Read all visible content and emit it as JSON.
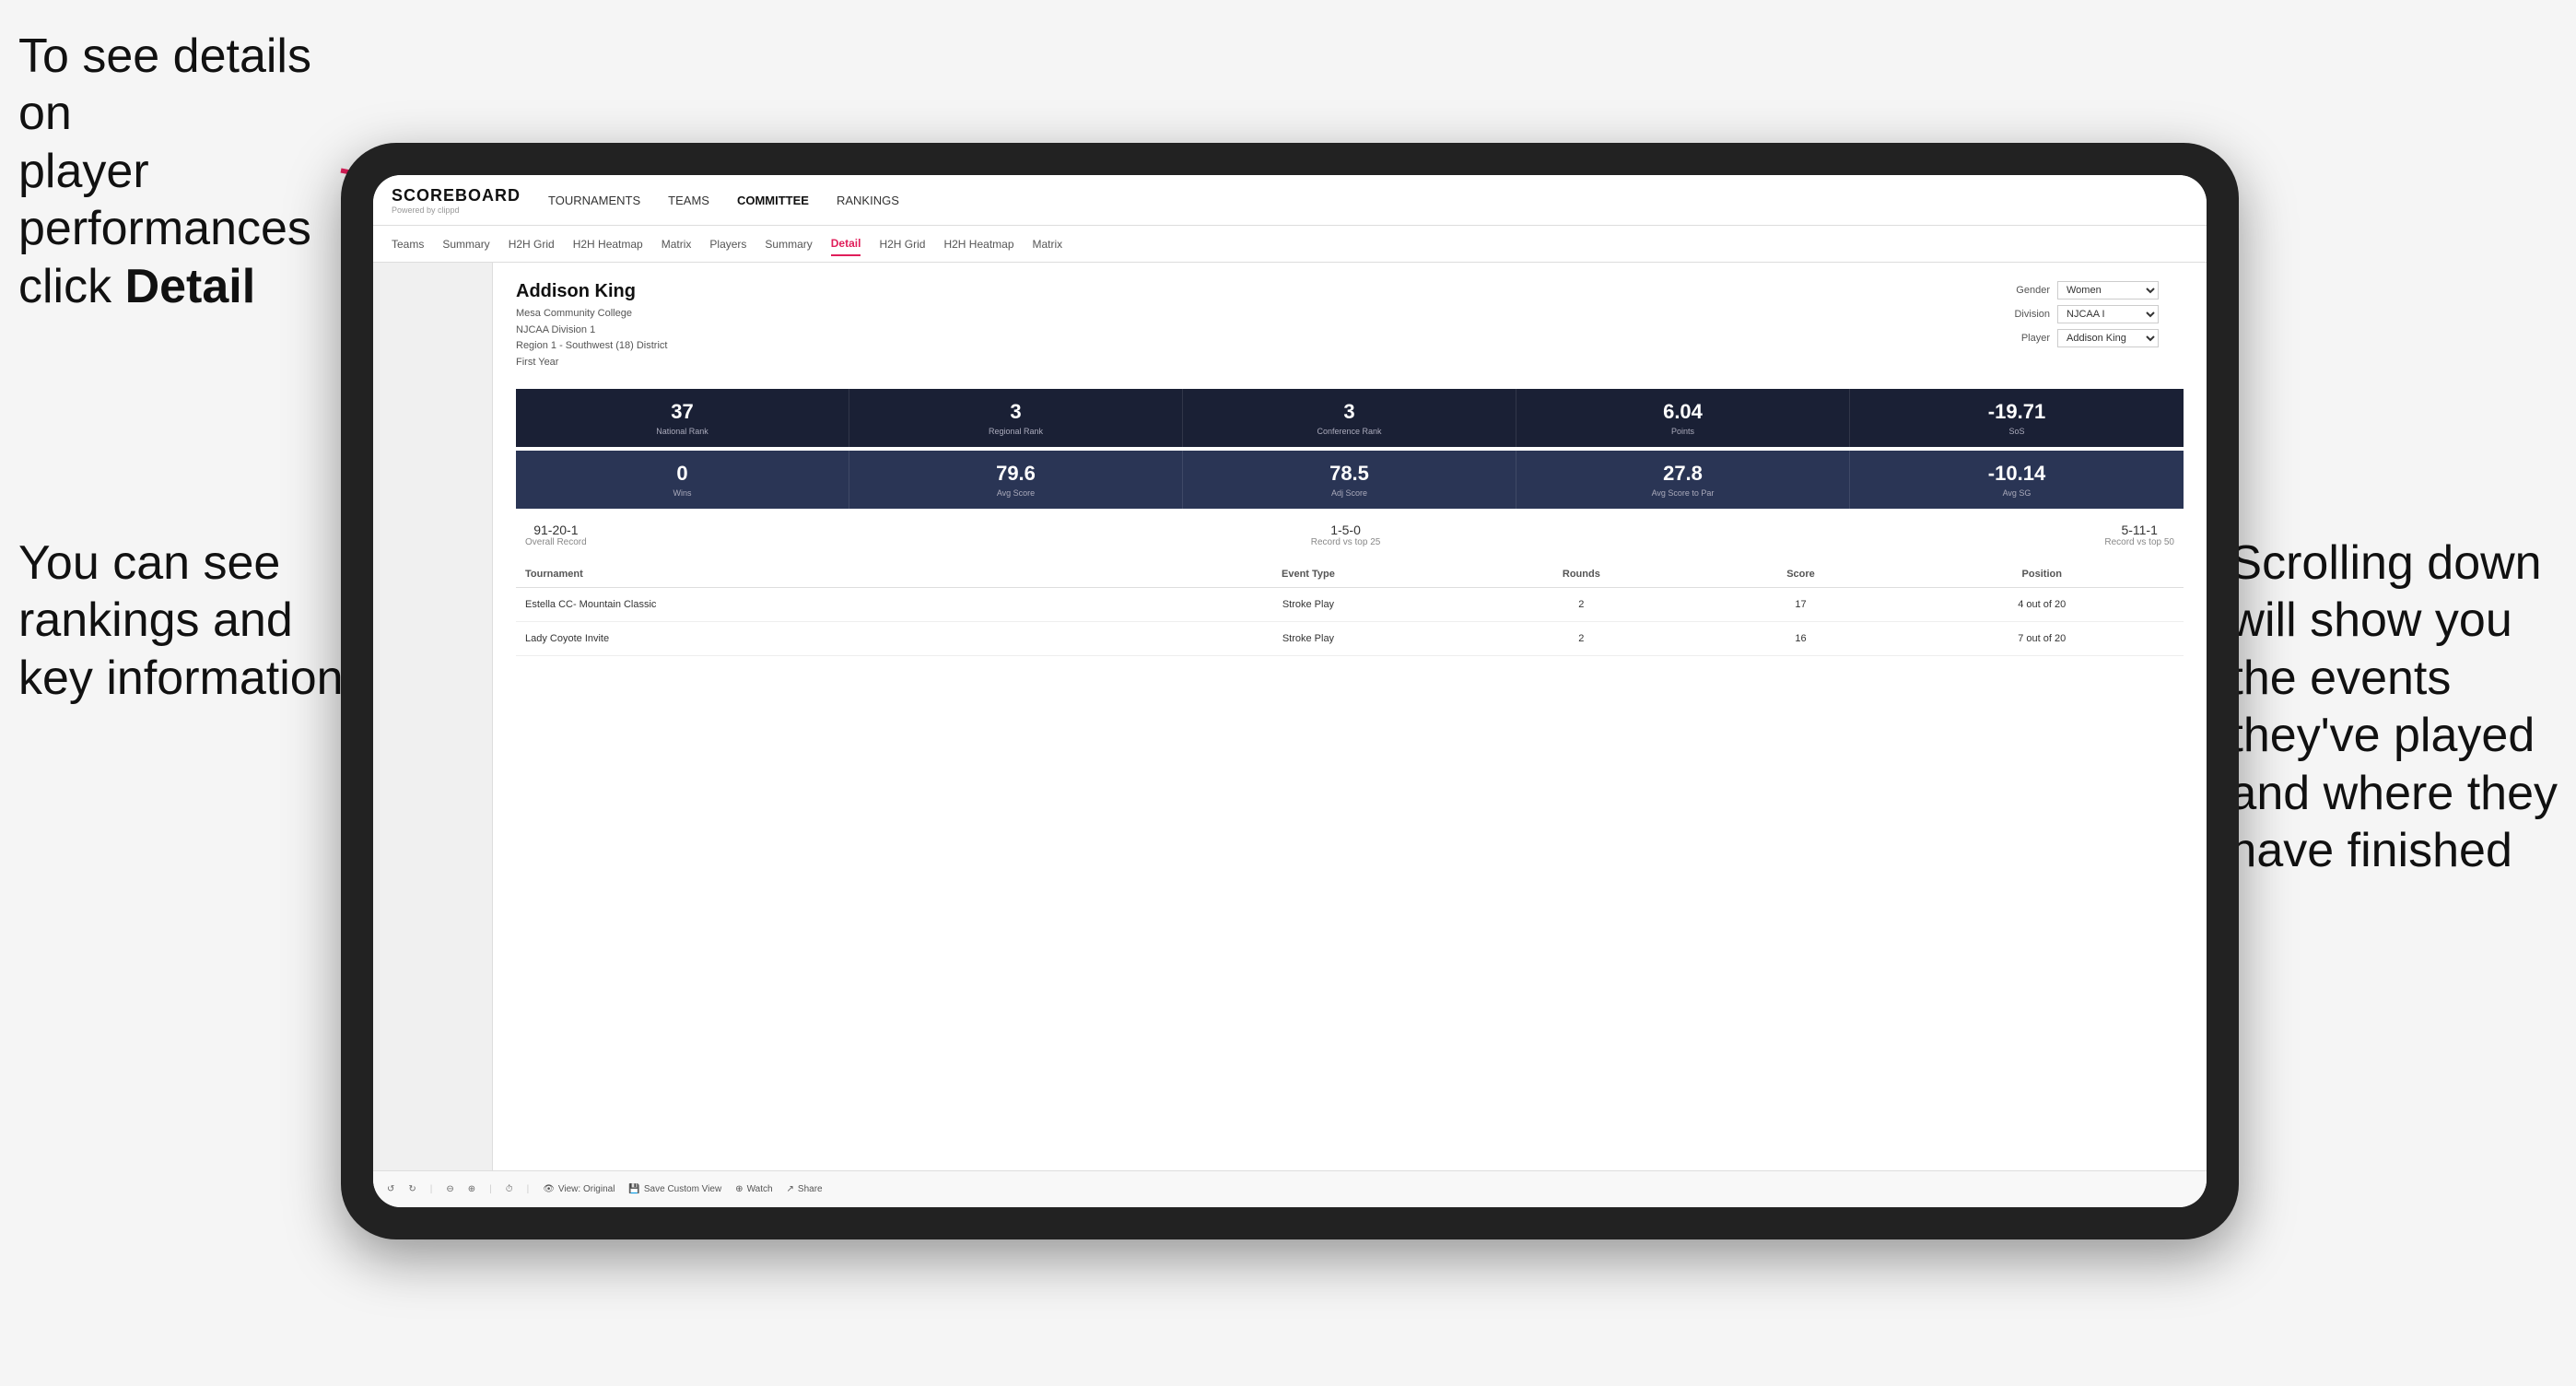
{
  "annotations": {
    "top_left": {
      "line1": "To see details on",
      "line2": "player performances",
      "line3_prefix": "click ",
      "line3_bold": "Detail"
    },
    "bottom_left": {
      "line1": "You can see",
      "line2": "rankings and",
      "line3": "key information"
    },
    "right": {
      "line1": "Scrolling down",
      "line2": "will show you",
      "line3": "the events",
      "line4": "they've played",
      "line5": "and where they",
      "line6": "have finished"
    }
  },
  "nav": {
    "logo": "SCOREBOARD",
    "powered_by": "Powered by clippd",
    "items": [
      "TOURNAMENTS",
      "TEAMS",
      "COMMITTEE",
      "RANKINGS"
    ]
  },
  "sub_nav": {
    "items": [
      "Teams",
      "Summary",
      "H2H Grid",
      "H2H Heatmap",
      "Matrix",
      "Players",
      "Summary",
      "Detail",
      "H2H Grid",
      "H2H Heatmap",
      "Matrix"
    ]
  },
  "player": {
    "name": "Addison King",
    "school": "Mesa Community College",
    "division": "NJCAA Division 1",
    "region": "Region 1 - Southwest (18) District",
    "year": "First Year"
  },
  "filters": {
    "gender_label": "Gender",
    "gender_value": "Women",
    "division_label": "Division",
    "division_value": "NJCAA I",
    "player_label": "Player",
    "player_value": "Addison King"
  },
  "stats_row1": [
    {
      "value": "37",
      "label": "National Rank"
    },
    {
      "value": "3",
      "label": "Regional Rank"
    },
    {
      "value": "3",
      "label": "Conference Rank"
    },
    {
      "value": "6.04",
      "label": "Points"
    },
    {
      "value": "-19.71",
      "label": "SoS"
    }
  ],
  "stats_row2": [
    {
      "value": "0",
      "label": "Wins"
    },
    {
      "value": "79.6",
      "label": "Avg Score"
    },
    {
      "value": "78.5",
      "label": "Adj Score"
    },
    {
      "value": "27.8",
      "label": "Avg Score to Par"
    },
    {
      "value": "-10.14",
      "label": "Avg SG"
    }
  ],
  "records": [
    {
      "value": "91-20-1",
      "label": "Overall Record"
    },
    {
      "value": "1-5-0",
      "label": "Record vs top 25"
    },
    {
      "value": "5-11-1",
      "label": "Record vs top 50"
    }
  ],
  "table": {
    "headers": [
      "Tournament",
      "Event Type",
      "Rounds",
      "Score",
      "Position"
    ],
    "rows": [
      {
        "tournament": "Estella CC- Mountain Classic",
        "event_type": "Stroke Play",
        "rounds": "2",
        "score": "17",
        "position": "4 out of 20"
      },
      {
        "tournament": "Lady Coyote Invite",
        "event_type": "Stroke Play",
        "rounds": "2",
        "score": "16",
        "position": "7 out of 20"
      }
    ]
  },
  "toolbar": {
    "buttons": [
      "View: Original",
      "Save Custom View",
      "Watch",
      "Share"
    ]
  }
}
